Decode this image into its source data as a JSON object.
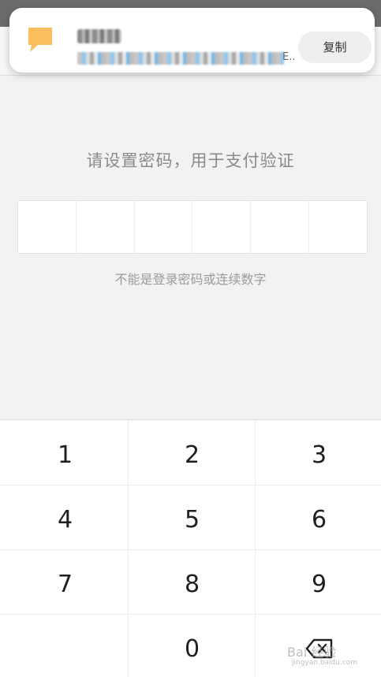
{
  "notification": {
    "copy_label": "复制",
    "ellipsis": "E.."
  },
  "page": {
    "title": "请设置密码，用于支付验证",
    "hint": "不能是登录密码或连续数字"
  },
  "pin": {
    "length": 6
  },
  "keypad": {
    "keys": [
      "1",
      "2",
      "3",
      "4",
      "5",
      "6",
      "7",
      "8",
      "9",
      "0"
    ]
  },
  "watermark": {
    "text": "Bai 经验",
    "sub": "jingyan.baidu.com"
  },
  "colors": {
    "background": "#f2f2f4",
    "notification_icon": "#fbbf5e",
    "copy_button": "#eeeeee"
  }
}
